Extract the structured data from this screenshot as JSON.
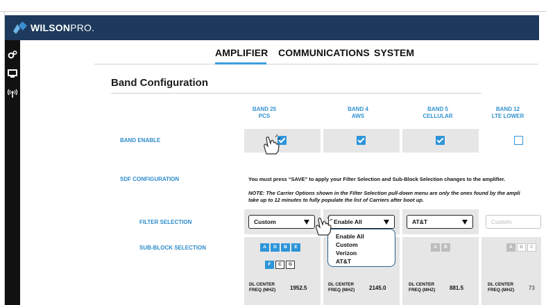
{
  "brand": {
    "bold": "WILSON",
    "thin": "PRO."
  },
  "rail": {
    "icons": [
      "gears-icon",
      "monitor-icon",
      "antenna-icon"
    ]
  },
  "nav": {
    "tabs": [
      "AMPLIFIER",
      "COMMUNICATIONS",
      "SYSTEM"
    ],
    "active": "AMPLIFIER"
  },
  "section_title": "Band Configuration",
  "bands": [
    {
      "name": "BAND 25",
      "sub": "PCS",
      "enabled": true,
      "filter": "Custom",
      "subblocks_row1": [
        "A",
        "D",
        "B",
        "E"
      ],
      "subblocks_row2": [
        "F",
        "C",
        "G"
      ],
      "dl_center": "1952.5"
    },
    {
      "name": "BAND 4",
      "sub": "AWS",
      "enabled": true,
      "filter": "Enable All",
      "dl_center": "2145.0"
    },
    {
      "name": "BAND 5",
      "sub": "CELLULAR",
      "enabled": true,
      "filter": "AT&T",
      "subblocks_row1": [
        "A",
        "B"
      ],
      "dl_center": "881.5"
    },
    {
      "name": "BAND 12",
      "sub": "LTE LOWER",
      "enabled": false,
      "filter": "Custom",
      "subblocks_row1": [
        "A",
        "B",
        "C"
      ],
      "dl_center": "73"
    }
  ],
  "labels": {
    "band_enable": "BAND ENABLE",
    "sdf": "SDF CONFIGURATION",
    "filter_selection": "FILTER SELECTION",
    "subblock_selection": "SUB-BLOCK SELECTION",
    "dl_center_line1": "DL CENTER",
    "dl_center_line2": "FREQ (MHZ)"
  },
  "notes": {
    "save": "You must press “SAVE” to apply your Filter Selection and Sub-Block Selection changes to the amplifier.",
    "carrier_line1": "NOTE: The Carrier Options shown in the Filter Selection pull-down menu are only the ones found by the ampli",
    "carrier_line2": "take up to 12 minutes to fully populate  the list of Carriers after boot up."
  },
  "dropdown_options": [
    "Enable All",
    "Custom",
    "Verizon",
    "AT&T"
  ],
  "colors": {
    "header": "#1d3a5c",
    "accent": "#2e95d9",
    "rail": "#111111"
  }
}
